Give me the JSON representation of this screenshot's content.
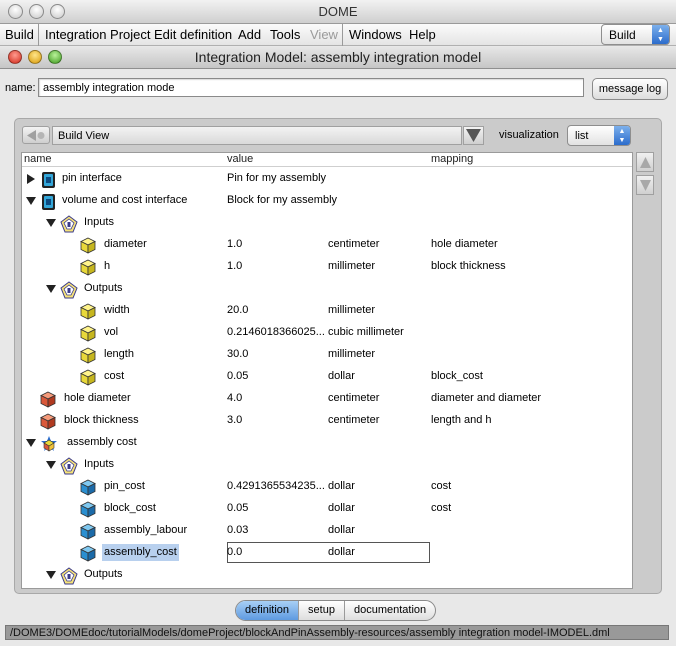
{
  "app_title": "DOME",
  "menu": {
    "items": [
      "Build",
      "Integration Project",
      "Edit definition",
      "Add",
      "Tools",
      "View",
      "Windows",
      "Help"
    ],
    "mode": "Build"
  },
  "window_title": "Integration Model: assembly integration model",
  "name_label": "name:",
  "name_value": "assembly integration mode",
  "message_log_label": "message log",
  "view_select": "Build View",
  "visualization_label": "visualization",
  "visualization_value": "list",
  "columns": {
    "name": "name",
    "value": "value",
    "mapping": "mapping"
  },
  "rows": [
    {
      "name": "pin interface",
      "value": "Pin  for my assembly",
      "unit": "",
      "mapping": "",
      "icon": "interface-icon",
      "twist": "closed"
    },
    {
      "name": "volume and cost interface",
      "value": "Block for my assembly",
      "unit": "",
      "mapping": "",
      "icon": "interface-icon",
      "twist": "open"
    },
    {
      "name": "Inputs",
      "value": "",
      "unit": "",
      "mapping": "",
      "icon": "filter-icon",
      "twist": "open"
    },
    {
      "name": "diameter",
      "value": "1.0",
      "unit": "centimeter",
      "mapping": "hole diameter",
      "icon": "param-yellow-icon",
      "twist": ""
    },
    {
      "name": "h",
      "value": "1.0",
      "unit": "millimeter",
      "mapping": "block thickness",
      "icon": "param-yellow-icon",
      "twist": ""
    },
    {
      "name": "Outputs",
      "value": "",
      "unit": "",
      "mapping": "",
      "icon": "filter-icon",
      "twist": "open"
    },
    {
      "name": "width",
      "value": "20.0",
      "unit": "millimeter",
      "mapping": "",
      "icon": "param-yellow-icon",
      "twist": ""
    },
    {
      "name": "vol",
      "value": "0.2146018366025...",
      "unit": "cubic millimeter",
      "mapping": "",
      "icon": "param-yellow-icon",
      "twist": ""
    },
    {
      "name": "length",
      "value": "30.0",
      "unit": "millimeter",
      "mapping": "",
      "icon": "param-yellow-icon",
      "twist": ""
    },
    {
      "name": "cost",
      "value": "0.05",
      "unit": "dollar",
      "mapping": "block_cost",
      "icon": "param-yellow-icon",
      "twist": ""
    },
    {
      "name": "hole diameter",
      "value": "4.0",
      "unit": "centimeter",
      "mapping": "diameter and diameter",
      "icon": "param-red-icon",
      "twist": ""
    },
    {
      "name": "block thickness",
      "value": "3.0",
      "unit": "centimeter",
      "mapping": "length and h",
      "icon": "param-red-icon",
      "twist": ""
    },
    {
      "name": "assembly cost",
      "value": "",
      "unit": "",
      "mapping": "",
      "icon": "model-icon",
      "twist": "open"
    },
    {
      "name": "Inputs",
      "value": "",
      "unit": "",
      "mapping": "",
      "icon": "filter-icon",
      "twist": "open"
    },
    {
      "name": "pin_cost",
      "value": "0.4291365534235...",
      "unit": "dollar",
      "mapping": "cost",
      "icon": "param-blue-icon",
      "twist": ""
    },
    {
      "name": "block_cost",
      "value": "0.05",
      "unit": "dollar",
      "mapping": "cost",
      "icon": "param-blue-icon",
      "twist": ""
    },
    {
      "name": "assembly_labour",
      "value": "0.03",
      "unit": "dollar",
      "mapping": "",
      "icon": "param-blue-icon",
      "twist": ""
    },
    {
      "name": "assembly_cost",
      "value": "0.0",
      "unit": "dollar",
      "mapping": "",
      "icon": "param-blue-icon",
      "twist": "",
      "selected": true
    },
    {
      "name": "Outputs",
      "value": "",
      "unit": "",
      "mapping": "",
      "icon": "filter-icon",
      "twist": "open"
    }
  ],
  "tabs": [
    "definition",
    "setup",
    "documentation"
  ],
  "active_tab": "definition",
  "status_path": "/DOME3/DOMEdoc/tutorialModels/domeProject/blockAndPinAssembly-resources/assembly integration model-IMODEL.dml",
  "colors": {
    "accent_blue": "#2c6ccc",
    "selection": "#b8d0ee",
    "param_yellow": "#e8d83a",
    "param_red": "#d9583a",
    "param_blue": "#2b8fd0"
  }
}
